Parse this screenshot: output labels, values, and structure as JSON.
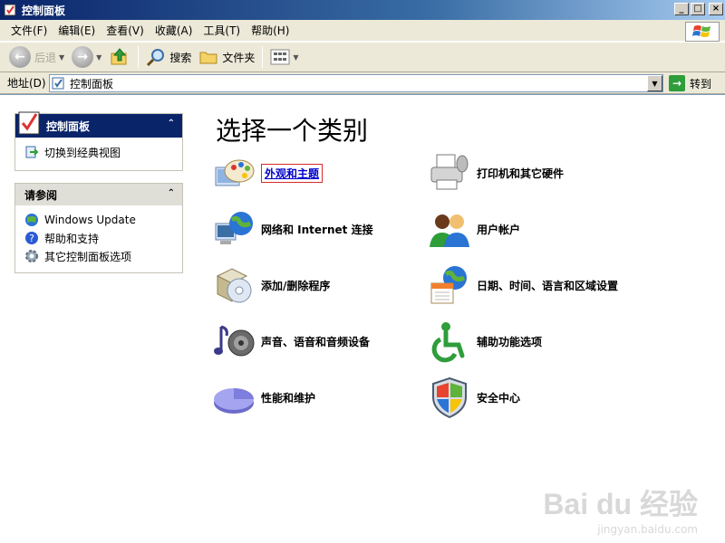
{
  "window": {
    "title": "控制面板"
  },
  "menu": [
    "文件(F)",
    "编辑(E)",
    "查看(V)",
    "收藏(A)",
    "工具(T)",
    "帮助(H)"
  ],
  "toolbar": {
    "back": "后退",
    "search": "搜索",
    "folders": "文件夹"
  },
  "address": {
    "label": "地址(D)",
    "value": "控制面板",
    "go": "转到"
  },
  "sidebar": {
    "control_panel": {
      "title": "控制面板",
      "switch_view": "切换到经典视图"
    },
    "see_also": {
      "title": "请参阅",
      "links": [
        "Windows Update",
        "帮助和支持",
        "其它控制面板选项"
      ]
    }
  },
  "main": {
    "heading": "选择一个类别",
    "categories": [
      {
        "label": "外观和主题",
        "icon": "appearance-icon"
      },
      {
        "label": "打印机和其它硬件",
        "icon": "printer-icon"
      },
      {
        "label": "网络和 Internet 连接",
        "icon": "network-icon"
      },
      {
        "label": "用户帐户",
        "icon": "users-icon"
      },
      {
        "label": "添加/删除程序",
        "icon": "add-remove-icon"
      },
      {
        "label": "日期、时间、语言和区域设置",
        "icon": "datetime-icon"
      },
      {
        "label": "声音、语音和音频设备",
        "icon": "sound-icon"
      },
      {
        "label": "辅助功能选项",
        "icon": "accessibility-icon"
      },
      {
        "label": "性能和维护",
        "icon": "performance-icon"
      },
      {
        "label": "安全中心",
        "icon": "security-shield-icon"
      }
    ]
  },
  "watermark": {
    "brand": "Bai du 经验",
    "url": "jingyan.baidu.com"
  },
  "colors": {
    "titlebar": "#0A246A",
    "link": "#0000CC",
    "highlight_box": "#D92A2A"
  }
}
